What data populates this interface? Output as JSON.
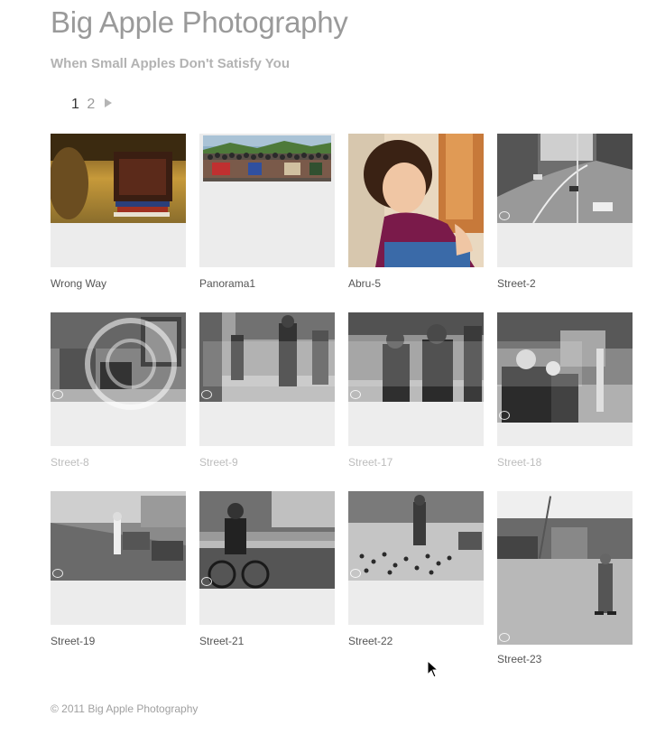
{
  "header": {
    "title": "Big Apple Photography",
    "tagline": "When Small Apples Don't Satisfy You"
  },
  "pagination": {
    "current": "1",
    "other": "2",
    "next_icon": "next-arrow-icon"
  },
  "gallery": {
    "items": [
      {
        "caption": "Wrong Way"
      },
      {
        "caption": "Panorama1"
      },
      {
        "caption": "Abru-5"
      },
      {
        "caption": "Street-2"
      },
      {
        "caption": "Street-8"
      },
      {
        "caption": "Street-9"
      },
      {
        "caption": "Street-17"
      },
      {
        "caption": "Street-18"
      },
      {
        "caption": "Street-19"
      },
      {
        "caption": "Street-21"
      },
      {
        "caption": "Street-22"
      },
      {
        "caption": "Street-23"
      }
    ]
  },
  "footer": {
    "copyright": "© 2011 Big Apple Photography"
  },
  "colors": {
    "title": "#9a9a9a",
    "tagline": "#b3b3b3",
    "placeholder": "#ececec"
  }
}
